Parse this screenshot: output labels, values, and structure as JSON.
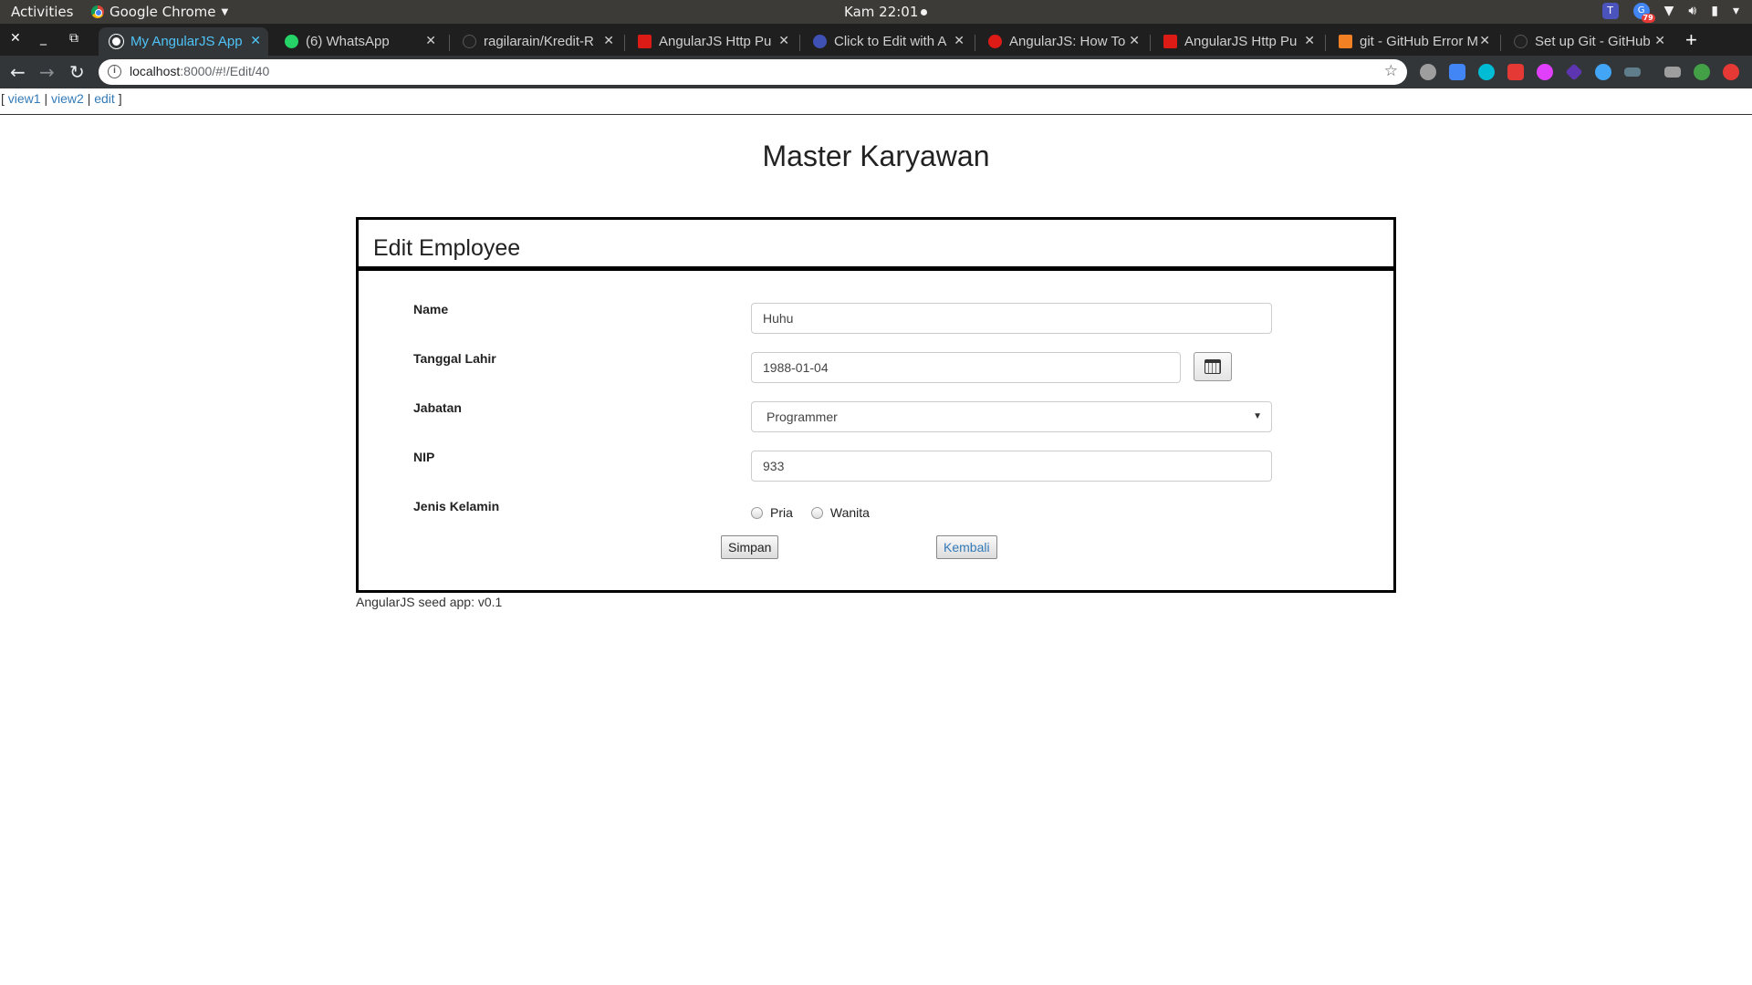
{
  "system_bar": {
    "activities": "Activities",
    "app_name": "Google Chrome",
    "clock": "Kam 22:01",
    "notification_badge": "79"
  },
  "tabs": [
    {
      "title": "My AngularJS App",
      "active": true,
      "favicon_color": "#ffffff"
    },
    {
      "title": "(6) WhatsApp",
      "active": false,
      "favicon_color": "#25d366"
    },
    {
      "title": "ragilarain/Kredit-R",
      "active": false,
      "favicon_color": "#222222"
    },
    {
      "title": "AngularJS Http Pu",
      "active": false,
      "favicon_color": "#dd1b16"
    },
    {
      "title": "Click to Edit with A",
      "active": false,
      "favicon_color": "#3f51b5"
    },
    {
      "title": "AngularJS: How To",
      "active": false,
      "favicon_color": "#dd1b16"
    },
    {
      "title": "AngularJS Http Pu",
      "active": false,
      "favicon_color": "#dd1b16"
    },
    {
      "title": "git - GitHub Error M",
      "active": false,
      "favicon_color": "#f48024"
    },
    {
      "title": "Set up Git - GitHub",
      "active": false,
      "favicon_color": "#222222"
    }
  ],
  "address_bar": {
    "host": "localhost",
    "path": ":8000/#!/Edit/40"
  },
  "nav_menu": {
    "open": "[",
    "view1": "view1",
    "sep1": "|",
    "view2": "view2",
    "sep2": "|",
    "edit": "edit",
    "close": "]"
  },
  "page": {
    "heading": "Master Karyawan",
    "panel_title": "Edit Employee",
    "footer": "AngularJS seed app: v0.1"
  },
  "form": {
    "name_label": "Name",
    "name_value": "Huhu",
    "dob_label": "Tanggal Lahir",
    "dob_value": "1988-01-04",
    "position_label": "Jabatan",
    "position_value": "Programmer",
    "nip_label": "NIP",
    "nip_value": "933",
    "gender_label": "Jenis Kelamin",
    "gender_option_male": "Pria",
    "gender_option_female": "Wanita",
    "save_button": "Simpan",
    "back_button": "Kembali"
  },
  "colors": {
    "link": "#337ab7",
    "active_tab_text": "#4fc3f7",
    "panel_border": "#000000"
  }
}
